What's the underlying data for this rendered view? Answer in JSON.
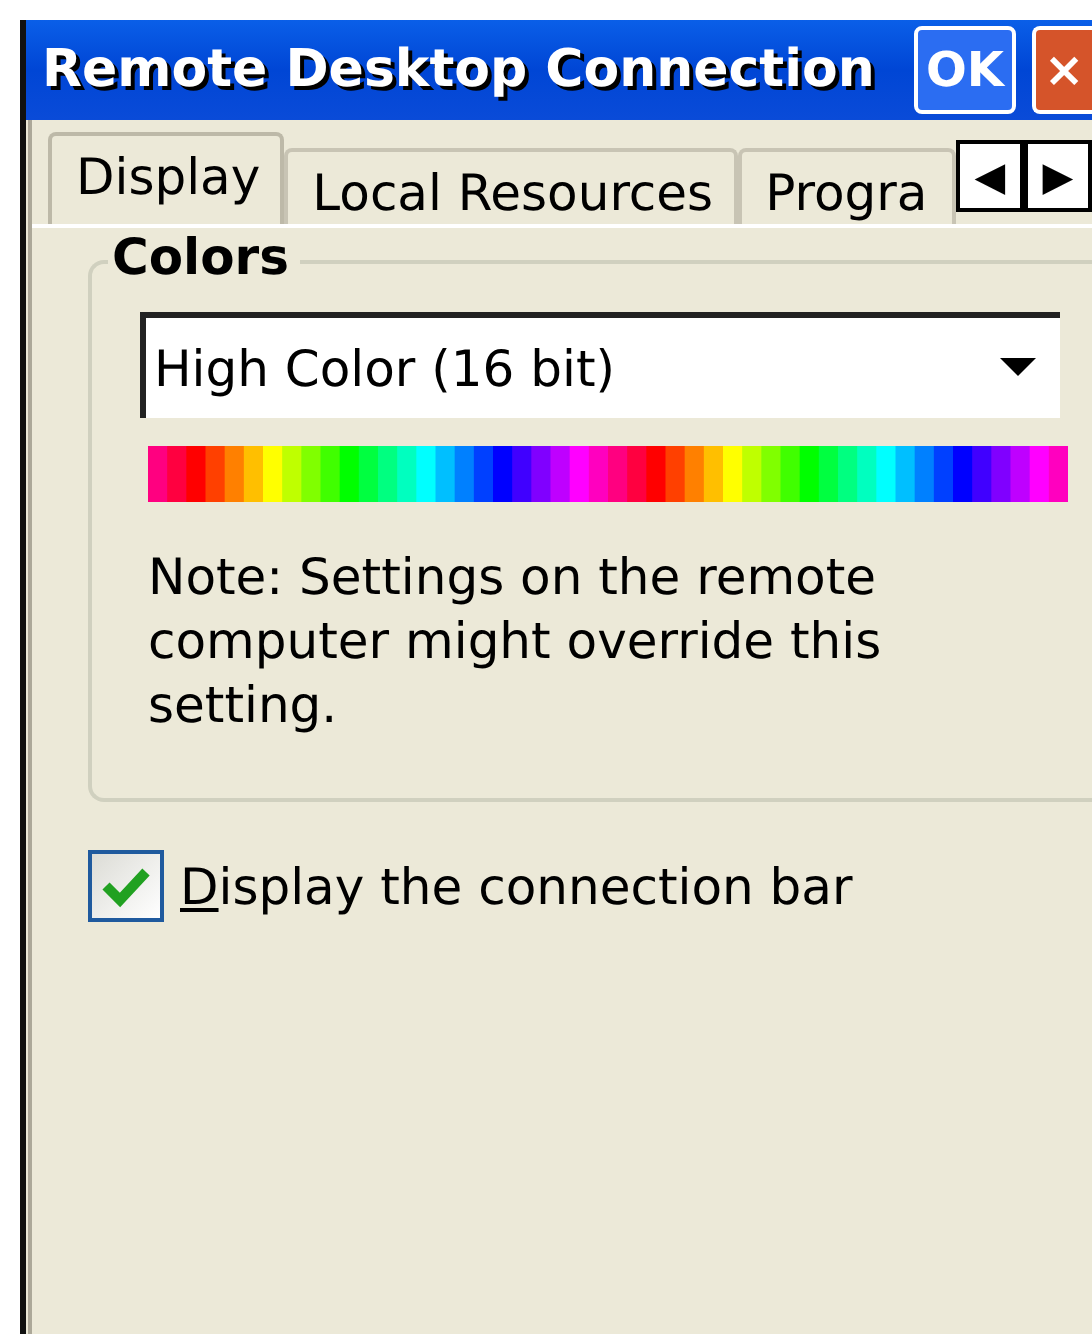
{
  "window": {
    "title": "Remote Desktop Connection",
    "buttons": [
      {
        "kind": "ok",
        "label": "OK"
      },
      {
        "kind": "close",
        "label": "×"
      }
    ]
  },
  "tabs": [
    {
      "label": "Display",
      "selected": true
    },
    {
      "label": "Local Resources",
      "selected": false
    },
    {
      "label": "Progra",
      "selected": false
    }
  ],
  "tab_scroll": [
    {
      "label": "◀"
    },
    {
      "label": "▶"
    }
  ],
  "colors_group": {
    "title": "Colors",
    "dropdown": {
      "value": "High Color (16 bit)"
    },
    "note": "Note: Settings on the remote computer might override this setting."
  },
  "connection_bar_checkbox": {
    "label": "Display the connection bar",
    "mnemonic_underlined": true,
    "checked": true
  }
}
